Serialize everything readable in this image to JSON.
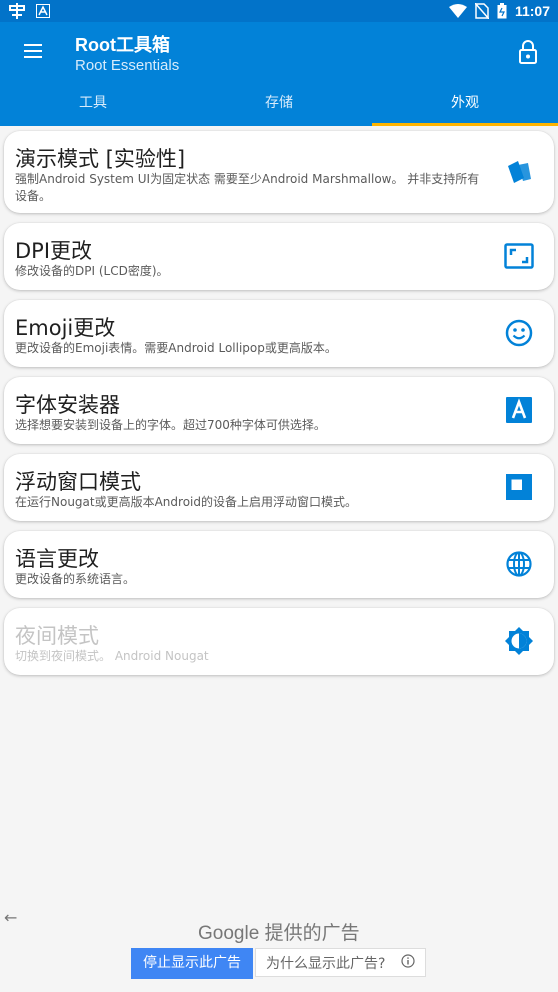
{
  "status_bar": {
    "time": "11:07",
    "left_icons": [
      "app-notification-icon",
      "a-badge-icon"
    ],
    "right_icons": [
      "wifi-icon",
      "no-sim-icon",
      "battery-icon"
    ]
  },
  "app_bar": {
    "title": "Root工具箱",
    "subtitle": "Root Essentials",
    "background": "#0282d8"
  },
  "tabs": [
    {
      "label": "工具",
      "active": false
    },
    {
      "label": "存储",
      "active": false
    },
    {
      "label": "外观",
      "active": true
    }
  ],
  "items": [
    {
      "title": "演示模式 [实验性]",
      "desc": "强制Android System UI为固定状态 需要至少Android Marshmallow。 并非支持所有设备。",
      "icon": "demo-mode-icon",
      "enabled": true
    },
    {
      "title": "DPI更改",
      "desc": "修改设备的DPI (LCD密度)。",
      "icon": "aspect-ratio-icon",
      "enabled": true
    },
    {
      "title": "Emoji更改",
      "desc": "更改设备的Emoji表情。需要Android Lollipop或更高版本。",
      "icon": "smiley-icon",
      "enabled": true
    },
    {
      "title": "字体安装器",
      "desc": "选择想要安装到设备上的字体。超过700种字体可供选择。",
      "icon": "font-icon",
      "enabled": true
    },
    {
      "title": "浮动窗口模式",
      "desc": "在运行Nougat或更高版本Android的设备上启用浮动窗口模式。",
      "icon": "floating-window-icon",
      "enabled": true
    },
    {
      "title": "语言更改",
      "desc": "更改设备的系统语言。",
      "icon": "globe-icon",
      "enabled": true
    },
    {
      "title": "夜间模式",
      "desc": "切换到夜间模式。 Android Nougat",
      "icon": "brightness-icon",
      "enabled": false
    }
  ],
  "ad": {
    "brand": "Google",
    "brand_suffix": "提供的广告",
    "stop_label": "停止显示此广告",
    "why_label": "为什么显示此广告?",
    "back_glyph": "←"
  },
  "colors": {
    "accent": "#0282d8",
    "tab_indicator": "#ffb400",
    "ad_button": "#3f86f4"
  }
}
